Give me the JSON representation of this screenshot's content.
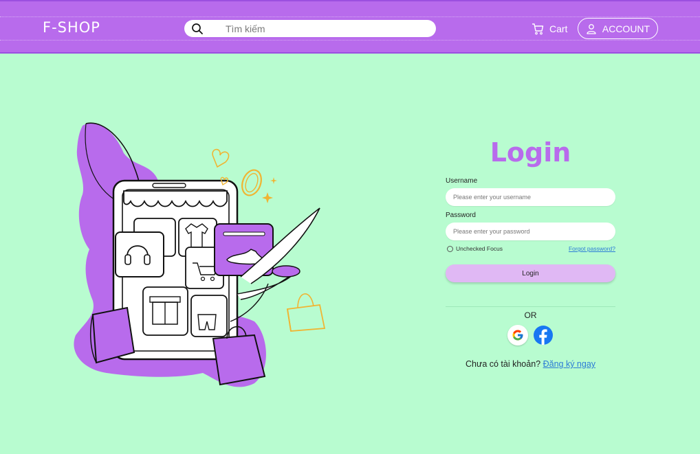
{
  "header": {
    "logo": "F-SHOP",
    "search_placeholder": "Tìm kiếm",
    "cart_label": "Cart",
    "account_label": "ACCOUNT"
  },
  "login": {
    "title": "Login",
    "username_label": "Username",
    "username_placeholder": "Please enter your username",
    "password_label": "Password",
    "password_placeholder": "Please enter your password",
    "remember_label": "Unchecked Focus",
    "forgot_label": "Forgot password?",
    "submit_label": "Login",
    "or_label": "OR",
    "signup_prompt": "Chưa có tài khoản?",
    "signup_link": "Đăng ký ngay"
  },
  "social": [
    "google-icon",
    "facebook-icon"
  ],
  "colors": {
    "header_bg": "#b86bec",
    "page_bg": "#b8fcd0",
    "accent": "#b86bec",
    "login_button": "#e0b8f4",
    "link": "#2b7bd6"
  }
}
